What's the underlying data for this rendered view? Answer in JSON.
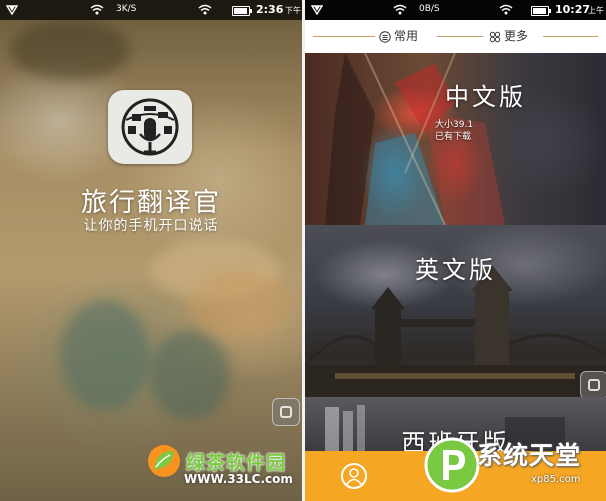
{
  "left_screen": {
    "status_bar": {
      "speed": "3K/S",
      "time": "2:36",
      "ampm": "下午"
    },
    "app_icon": "translator-globe-mic-icon",
    "app_name": "旅行翻译官",
    "slogan": "让你的手机开口说话",
    "watermark": {
      "name": "绿茶软件园",
      "url": "WWW.33LC.com"
    }
  },
  "right_screen": {
    "status_bar": {
      "speed": "0B/S",
      "time": "10:27",
      "ampm": "上午"
    },
    "tabs": [
      {
        "label": "常用",
        "icon": "list-circle-icon"
      },
      {
        "label": "更多",
        "icon": "grid-icon"
      }
    ],
    "languages": [
      {
        "title": "中文版",
        "subtitle_line1": "大小39.1",
        "subtitle_line2": "已有下载"
      },
      {
        "title": "英文版"
      },
      {
        "title": "西班牙版"
      }
    ],
    "bottom_bar": {
      "icon": "user-profile-icon"
    },
    "watermark": {
      "name": "系统天堂",
      "url": "xp85.com"
    }
  },
  "colors": {
    "accent": "#f5a623",
    "watermark_green": "#7ac943",
    "tab_line": "#c8a068"
  }
}
